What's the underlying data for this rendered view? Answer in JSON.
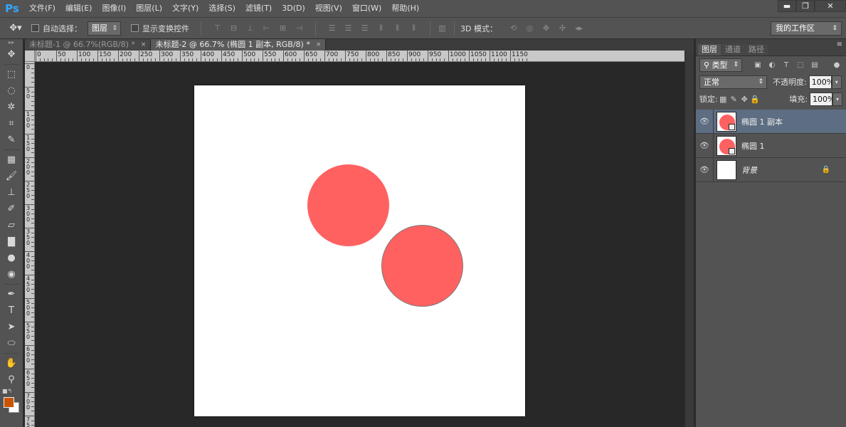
{
  "app": {
    "logo": "Ps"
  },
  "menu": [
    "文件(F)",
    "编辑(E)",
    "图像(I)",
    "图层(L)",
    "文字(Y)",
    "选择(S)",
    "滤镜(T)",
    "3D(D)",
    "视图(V)",
    "窗口(W)",
    "帮助(H)"
  ],
  "window_controls": {
    "minimize": "▬",
    "restore": "❐",
    "close": "✕"
  },
  "options": {
    "auto_select_label": "自动选择：",
    "auto_select_value": "图层",
    "show_transform_label": "显示变换控件",
    "mode_3d_label": "3D 模式：",
    "workspace": "我的工作区"
  },
  "tabs": [
    {
      "label": "未标题-1 @ 66.7%(RGB/8) *",
      "close": "×",
      "active": false
    },
    {
      "label": "未标题-2 @ 66.7% (椭圆 1 副本, RGB/8) *",
      "close": "×",
      "active": true
    }
  ],
  "ruler_h": [
    "0",
    "50",
    "100",
    "150",
    "200",
    "250",
    "300",
    "350",
    "400",
    "450",
    "500",
    "550",
    "600",
    "650",
    "700",
    "750",
    "800",
    "850",
    "900",
    "950",
    "1000",
    "1050",
    "1100",
    "1150"
  ],
  "ruler_v": [
    "0",
    "50",
    "100",
    "150",
    "200",
    "250",
    "300",
    "350",
    "400",
    "450",
    "500",
    "550",
    "600",
    "650",
    "700",
    "750"
  ],
  "colors": {
    "foreground": "#c85400",
    "background": "#ffffff",
    "shape_fill": "#ff6161"
  },
  "layers_panel": {
    "tabs": [
      "图层",
      "通道",
      "路径"
    ],
    "filter_kind": "类型",
    "blend_mode": "正常",
    "opacity_label": "不透明度:",
    "opacity_value": "100%",
    "lock_label": "锁定:",
    "fill_label": "填充:",
    "fill_value": "100%",
    "layers": [
      {
        "name": "椭圆 1 副本",
        "selected": true
      },
      {
        "name": "椭圆 1",
        "selected": false
      },
      {
        "name": "背景",
        "selected": false
      }
    ]
  }
}
